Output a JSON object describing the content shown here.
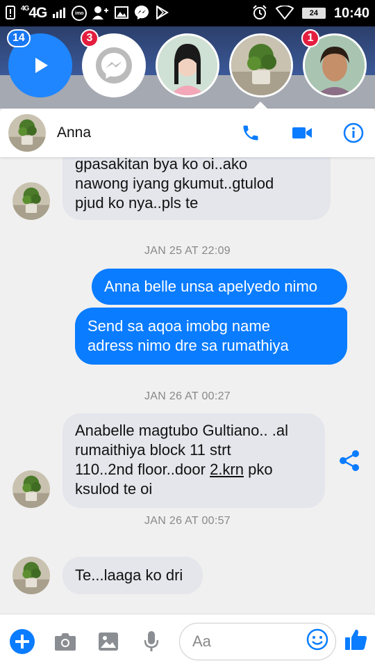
{
  "status_bar": {
    "network": "4G",
    "network_small": "4G",
    "battery": "24",
    "time": "10:40",
    "imo": "imo"
  },
  "chat_heads": [
    {
      "badge": "14",
      "icon": "play-icon"
    },
    {
      "badge": "3",
      "icon": "messenger-icon"
    },
    {
      "badge": "",
      "icon": "contact-avatar"
    },
    {
      "badge": "",
      "icon": "plant-avatar"
    },
    {
      "badge": "1",
      "icon": "contact-avatar"
    }
  ],
  "header": {
    "contact_name": "Anna"
  },
  "messages": [
    {
      "side": "in",
      "lines": [
        "gpasakitan bya ko oi..ako",
        "nawong iyang gkumut..gtulod",
        "pjud ko nya..pls te"
      ]
    },
    {
      "timestamp": "JAN 25 AT 22:09"
    },
    {
      "side": "out",
      "lines": [
        "Anna belle unsa apelyedo nimo"
      ]
    },
    {
      "side": "out",
      "lines": [
        "Send sa aqoa imobg name",
        "adress nimo dre sa rumathiya"
      ]
    },
    {
      "timestamp": "JAN 26 AT 00:27"
    },
    {
      "side": "in",
      "lines": [
        "Anabelle magtubo Gultiano.. .al",
        "rumaithiya block 11 strt",
        "110..2nd floor..door ",
        "2.krn",
        " pko",
        "ksulod te oi"
      ]
    },
    {
      "timestamp": "JAN 26 AT 00:57"
    },
    {
      "side": "in",
      "lines": [
        "Te...laaga ko dri"
      ]
    }
  ],
  "composer": {
    "placeholder": "Aa"
  },
  "colors": {
    "accent": "#0a7cff",
    "badge_red": "#e41e3f",
    "incoming_bubble": "#e4e6eb"
  }
}
